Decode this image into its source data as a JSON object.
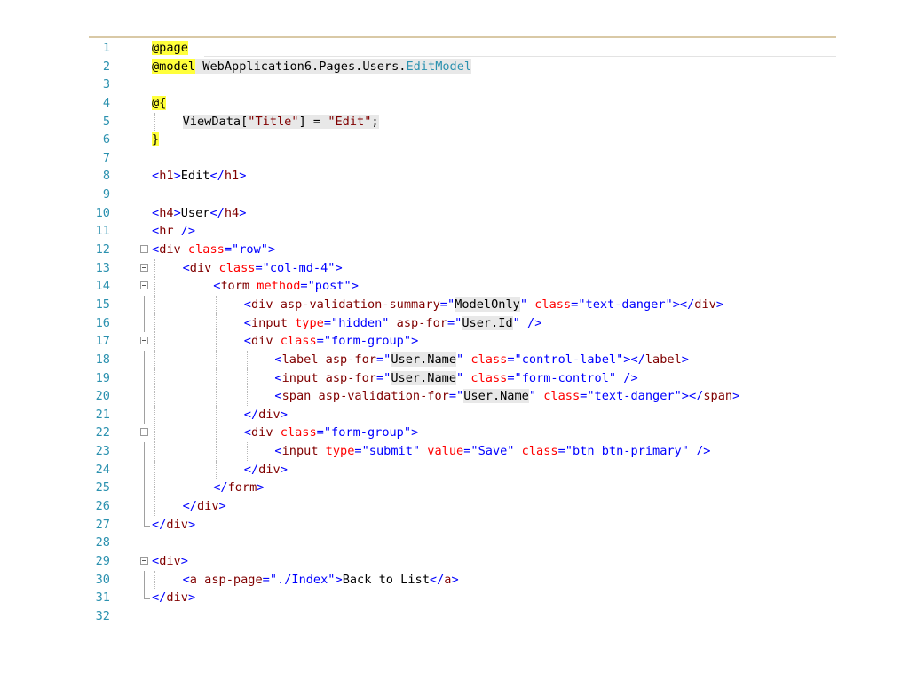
{
  "editor": {
    "lines": [
      {
        "n": "1",
        "indent": 0,
        "fold": "none",
        "tokens": [
          {
            "t": "@page",
            "c": "razor"
          }
        ]
      },
      {
        "n": "2",
        "indent": 0,
        "fold": "none",
        "tokens": [
          {
            "t": "@model",
            "c": "razor"
          },
          {
            "t": " WebApplication6.Pages.Users.",
            "c": "tx hl"
          },
          {
            "t": "EditModel",
            "c": "tk hl"
          }
        ]
      },
      {
        "n": "3",
        "indent": 0,
        "fold": "none",
        "tokens": []
      },
      {
        "n": "4",
        "indent": 0,
        "fold": "none",
        "tokens": [
          {
            "t": "@{",
            "c": "razor"
          }
        ]
      },
      {
        "n": "5",
        "indent": 1,
        "fold": "none",
        "tokens": [
          {
            "t": "ViewData[",
            "c": "tx hl"
          },
          {
            "t": "\"Title\"",
            "c": "m hl"
          },
          {
            "t": "] = ",
            "c": "tx hl"
          },
          {
            "t": "\"Edit\"",
            "c": "m hl"
          },
          {
            "t": ";",
            "c": "tx hl"
          }
        ]
      },
      {
        "n": "6",
        "indent": 0,
        "fold": "none",
        "tokens": [
          {
            "t": "}",
            "c": "razor"
          }
        ]
      },
      {
        "n": "7",
        "indent": 0,
        "fold": "none",
        "tokens": []
      },
      {
        "n": "8",
        "indent": 0,
        "fold": "none",
        "tokens": [
          {
            "t": "<",
            "c": "b"
          },
          {
            "t": "h1",
            "c": "m"
          },
          {
            "t": ">",
            "c": "b"
          },
          {
            "t": "Edit",
            "c": "tx"
          },
          {
            "t": "</",
            "c": "b"
          },
          {
            "t": "h1",
            "c": "m"
          },
          {
            "t": ">",
            "c": "b"
          }
        ]
      },
      {
        "n": "9",
        "indent": 0,
        "fold": "none",
        "tokens": []
      },
      {
        "n": "10",
        "indent": 0,
        "fold": "none",
        "tokens": [
          {
            "t": "<",
            "c": "b"
          },
          {
            "t": "h4",
            "c": "m"
          },
          {
            "t": ">",
            "c": "b"
          },
          {
            "t": "User",
            "c": "tx"
          },
          {
            "t": "</",
            "c": "b"
          },
          {
            "t": "h4",
            "c": "m"
          },
          {
            "t": ">",
            "c": "b"
          }
        ]
      },
      {
        "n": "11",
        "indent": 0,
        "fold": "none",
        "tokens": [
          {
            "t": "<",
            "c": "b"
          },
          {
            "t": "hr",
            "c": "m"
          },
          {
            "t": " />",
            "c": "b"
          }
        ]
      },
      {
        "n": "12",
        "indent": 0,
        "fold": "open",
        "tokens": [
          {
            "t": "<",
            "c": "b"
          },
          {
            "t": "div",
            "c": "m"
          },
          {
            "t": " class",
            "c": "a"
          },
          {
            "t": "=",
            "c": "b"
          },
          {
            "t": "\"row\"",
            "c": "s"
          },
          {
            "t": ">",
            "c": "b"
          }
        ]
      },
      {
        "n": "13",
        "indent": 1,
        "fold": "open",
        "tokens": [
          {
            "t": "<",
            "c": "b"
          },
          {
            "t": "div",
            "c": "m"
          },
          {
            "t": " class",
            "c": "a"
          },
          {
            "t": "=",
            "c": "b"
          },
          {
            "t": "\"col-md-4\"",
            "c": "s"
          },
          {
            "t": ">",
            "c": "b"
          }
        ]
      },
      {
        "n": "14",
        "indent": 2,
        "fold": "open",
        "tokens": [
          {
            "t": "<",
            "c": "b"
          },
          {
            "t": "form",
            "c": "m"
          },
          {
            "t": " method",
            "c": "a"
          },
          {
            "t": "=",
            "c": "b"
          },
          {
            "t": "\"post\"",
            "c": "s"
          },
          {
            "t": ">",
            "c": "b"
          }
        ]
      },
      {
        "n": "15",
        "indent": 3,
        "fold": "rail",
        "tokens": [
          {
            "t": "<",
            "c": "b"
          },
          {
            "t": "div",
            "c": "m"
          },
          {
            "t": " asp-validation-summary",
            "c": "m"
          },
          {
            "t": "=",
            "c": "b"
          },
          {
            "t": "\"",
            "c": "s"
          },
          {
            "t": "ModelOnly",
            "c": "tx hl"
          },
          {
            "t": "\"",
            "c": "s"
          },
          {
            "t": " class",
            "c": "a"
          },
          {
            "t": "=",
            "c": "b"
          },
          {
            "t": "\"text-danger\"",
            "c": "s"
          },
          {
            "t": "></",
            "c": "b"
          },
          {
            "t": "div",
            "c": "m"
          },
          {
            "t": ">",
            "c": "b"
          }
        ]
      },
      {
        "n": "16",
        "indent": 3,
        "fold": "rail",
        "tokens": [
          {
            "t": "<",
            "c": "b"
          },
          {
            "t": "input",
            "c": "m"
          },
          {
            "t": " type",
            "c": "a"
          },
          {
            "t": "=",
            "c": "b"
          },
          {
            "t": "\"hidden\"",
            "c": "s"
          },
          {
            "t": " asp-for",
            "c": "m"
          },
          {
            "t": "=",
            "c": "b"
          },
          {
            "t": "\"",
            "c": "s"
          },
          {
            "t": "User.Id",
            "c": "tx hl"
          },
          {
            "t": "\"",
            "c": "s"
          },
          {
            "t": " />",
            "c": "b"
          }
        ]
      },
      {
        "n": "17",
        "indent": 3,
        "fold": "open",
        "tokens": [
          {
            "t": "<",
            "c": "b"
          },
          {
            "t": "div",
            "c": "m"
          },
          {
            "t": " class",
            "c": "a"
          },
          {
            "t": "=",
            "c": "b"
          },
          {
            "t": "\"form-group\"",
            "c": "s"
          },
          {
            "t": ">",
            "c": "b"
          }
        ]
      },
      {
        "n": "18",
        "indent": 4,
        "fold": "rail",
        "tokens": [
          {
            "t": "<",
            "c": "b"
          },
          {
            "t": "label",
            "c": "m"
          },
          {
            "t": " asp-for",
            "c": "m"
          },
          {
            "t": "=",
            "c": "b"
          },
          {
            "t": "\"",
            "c": "s"
          },
          {
            "t": "User.Name",
            "c": "tx hl"
          },
          {
            "t": "\"",
            "c": "s"
          },
          {
            "t": " class",
            "c": "a"
          },
          {
            "t": "=",
            "c": "b"
          },
          {
            "t": "\"control-label\"",
            "c": "s"
          },
          {
            "t": "></",
            "c": "b"
          },
          {
            "t": "label",
            "c": "m"
          },
          {
            "t": ">",
            "c": "b"
          }
        ]
      },
      {
        "n": "19",
        "indent": 4,
        "fold": "rail",
        "tokens": [
          {
            "t": "<",
            "c": "b"
          },
          {
            "t": "input",
            "c": "m"
          },
          {
            "t": " asp-for",
            "c": "m"
          },
          {
            "t": "=",
            "c": "b"
          },
          {
            "t": "\"",
            "c": "s"
          },
          {
            "t": "User.Name",
            "c": "tx hl"
          },
          {
            "t": "\"",
            "c": "s"
          },
          {
            "t": " class",
            "c": "a"
          },
          {
            "t": "=",
            "c": "b"
          },
          {
            "t": "\"form-control\"",
            "c": "s"
          },
          {
            "t": " />",
            "c": "b"
          }
        ]
      },
      {
        "n": "20",
        "indent": 4,
        "fold": "rail",
        "tokens": [
          {
            "t": "<",
            "c": "b"
          },
          {
            "t": "span",
            "c": "m"
          },
          {
            "t": " asp-validation-for",
            "c": "m"
          },
          {
            "t": "=",
            "c": "b"
          },
          {
            "t": "\"",
            "c": "s"
          },
          {
            "t": "User.Name",
            "c": "tx hl"
          },
          {
            "t": "\"",
            "c": "s"
          },
          {
            "t": " class",
            "c": "a"
          },
          {
            "t": "=",
            "c": "b"
          },
          {
            "t": "\"text-danger\"",
            "c": "s"
          },
          {
            "t": "></",
            "c": "b"
          },
          {
            "t": "span",
            "c": "m"
          },
          {
            "t": ">",
            "c": "b"
          }
        ]
      },
      {
        "n": "21",
        "indent": 3,
        "fold": "rail",
        "tokens": [
          {
            "t": "</",
            "c": "b"
          },
          {
            "t": "div",
            "c": "m"
          },
          {
            "t": ">",
            "c": "b"
          }
        ]
      },
      {
        "n": "22",
        "indent": 3,
        "fold": "open",
        "tokens": [
          {
            "t": "<",
            "c": "b"
          },
          {
            "t": "div",
            "c": "m"
          },
          {
            "t": " class",
            "c": "a"
          },
          {
            "t": "=",
            "c": "b"
          },
          {
            "t": "\"form-group\"",
            "c": "s"
          },
          {
            "t": ">",
            "c": "b"
          }
        ]
      },
      {
        "n": "23",
        "indent": 4,
        "fold": "rail",
        "tokens": [
          {
            "t": "<",
            "c": "b"
          },
          {
            "t": "input",
            "c": "m"
          },
          {
            "t": " type",
            "c": "a"
          },
          {
            "t": "=",
            "c": "b"
          },
          {
            "t": "\"submit\"",
            "c": "s"
          },
          {
            "t": " value",
            "c": "a"
          },
          {
            "t": "=",
            "c": "b"
          },
          {
            "t": "\"Save\"",
            "c": "s"
          },
          {
            "t": " class",
            "c": "a"
          },
          {
            "t": "=",
            "c": "b"
          },
          {
            "t": "\"btn btn-primary\"",
            "c": "s"
          },
          {
            "t": " />",
            "c": "b"
          }
        ]
      },
      {
        "n": "24",
        "indent": 3,
        "fold": "rail",
        "tokens": [
          {
            "t": "</",
            "c": "b"
          },
          {
            "t": "div",
            "c": "m"
          },
          {
            "t": ">",
            "c": "b"
          }
        ]
      },
      {
        "n": "25",
        "indent": 2,
        "fold": "rail",
        "tokens": [
          {
            "t": "</",
            "c": "b"
          },
          {
            "t": "form",
            "c": "m"
          },
          {
            "t": ">",
            "c": "b"
          }
        ]
      },
      {
        "n": "26",
        "indent": 1,
        "fold": "rail",
        "tokens": [
          {
            "t": "</",
            "c": "b"
          },
          {
            "t": "div",
            "c": "m"
          },
          {
            "t": ">",
            "c": "b"
          }
        ]
      },
      {
        "n": "27",
        "indent": 0,
        "fold": "end",
        "tokens": [
          {
            "t": "</",
            "c": "b"
          },
          {
            "t": "div",
            "c": "m"
          },
          {
            "t": ">",
            "c": "b"
          }
        ]
      },
      {
        "n": "28",
        "indent": 0,
        "fold": "none",
        "tokens": []
      },
      {
        "n": "29",
        "indent": 0,
        "fold": "open",
        "tokens": [
          {
            "t": "<",
            "c": "b"
          },
          {
            "t": "div",
            "c": "m"
          },
          {
            "t": ">",
            "c": "b"
          }
        ]
      },
      {
        "n": "30",
        "indent": 1,
        "fold": "rail",
        "tokens": [
          {
            "t": "<",
            "c": "b"
          },
          {
            "t": "a",
            "c": "m"
          },
          {
            "t": " asp-page",
            "c": "m"
          },
          {
            "t": "=",
            "c": "b"
          },
          {
            "t": "\"./Index\"",
            "c": "s"
          },
          {
            "t": ">",
            "c": "b"
          },
          {
            "t": "Back to List",
            "c": "tx"
          },
          {
            "t": "</",
            "c": "b"
          },
          {
            "t": "a",
            "c": "m"
          },
          {
            "t": ">",
            "c": "b"
          }
        ]
      },
      {
        "n": "31",
        "indent": 0,
        "fold": "end",
        "tokens": [
          {
            "t": "</",
            "c": "b"
          },
          {
            "t": "div",
            "c": "m"
          },
          {
            "t": ">",
            "c": "b"
          }
        ]
      },
      {
        "n": "32",
        "indent": 0,
        "fold": "none",
        "tokens": []
      }
    ]
  }
}
